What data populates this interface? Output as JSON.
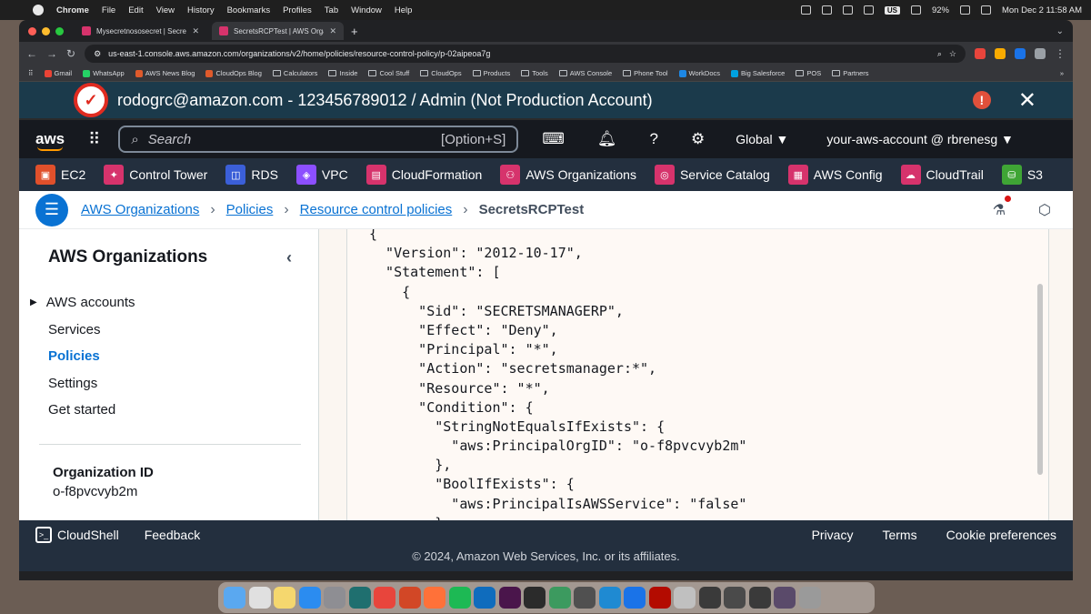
{
  "menubar": {
    "app": "Chrome",
    "items": [
      "File",
      "Edit",
      "View",
      "History",
      "Bookmarks",
      "Profiles",
      "Tab",
      "Window",
      "Help"
    ],
    "keyboard": "US",
    "battery": "92%",
    "clock": "Mon Dec 2  11:58 AM"
  },
  "browser": {
    "tabs": [
      {
        "label": "Mysecretnososecret | Secre",
        "active": false
      },
      {
        "label": "SecretsRCPTest | AWS Organ",
        "active": true
      }
    ],
    "url": "us-east-1.console.aws.amazon.com/organizations/v2/home/policies/resource-control-policy/p-02aipeoa7g",
    "bookmarks": [
      {
        "label": "Gmail",
        "color": "#ea4335",
        "folder": false
      },
      {
        "label": "WhatsApp",
        "color": "#25d366",
        "folder": false
      },
      {
        "label": "AWS News Blog",
        "color": "#e05a2b",
        "folder": false
      },
      {
        "label": "CloudOps Blog",
        "color": "#e05a2b",
        "folder": false
      },
      {
        "label": "Calculators",
        "folder": true
      },
      {
        "label": "Inside",
        "folder": true
      },
      {
        "label": "Cool Stuff",
        "folder": true
      },
      {
        "label": "CloudOps",
        "folder": true
      },
      {
        "label": "Products",
        "folder": true
      },
      {
        "label": "Tools",
        "folder": true
      },
      {
        "label": "AWS Console",
        "folder": true
      },
      {
        "label": "Phone Tool",
        "folder": true
      },
      {
        "label": "WorkDocs",
        "color": "#1e88e5",
        "folder": false
      },
      {
        "label": "Big Salesforce",
        "color": "#00a1e0",
        "folder": false
      },
      {
        "label": "POS",
        "folder": true
      },
      {
        "label": "Partners",
        "folder": true
      }
    ],
    "more": "»"
  },
  "banner": {
    "text": "rodogrc@amazon.com - 123456789012 / Admin (Not Production Account)",
    "alert": "!",
    "close": "✕"
  },
  "awsnav": {
    "logo": "aws",
    "search_placeholder": "Search",
    "search_shortcut": "[Option+S]",
    "region": "Global ▼",
    "account": "your-aws-account @ rbrenesg ▼"
  },
  "favorites": [
    {
      "label": "EC2",
      "color": "#e0502b",
      "glyph": "▣"
    },
    {
      "label": "Control Tower",
      "color": "#d6336c",
      "glyph": "✦"
    },
    {
      "label": "RDS",
      "color": "#3b5fd8",
      "glyph": "◫"
    },
    {
      "label": "VPC",
      "color": "#8c4fff",
      "glyph": "◈"
    },
    {
      "label": "CloudFormation",
      "color": "#d6336c",
      "glyph": "▤"
    },
    {
      "label": "AWS Organizations",
      "color": "#d6336c",
      "glyph": "⚇"
    },
    {
      "label": "Service Catalog",
      "color": "#d6336c",
      "glyph": "◎"
    },
    {
      "label": "AWS Config",
      "color": "#d6336c",
      "glyph": "▦"
    },
    {
      "label": "CloudTrail",
      "color": "#d6336c",
      "glyph": "☁"
    },
    {
      "label": "S3",
      "color": "#3fa535",
      "glyph": "⛁"
    }
  ],
  "breadcrumbs": {
    "links": [
      "AWS Organizations",
      "Policies",
      "Resource control policies"
    ],
    "current": "SecretsRCPTest"
  },
  "sidebar": {
    "title": "AWS Organizations",
    "items": [
      {
        "label": "AWS accounts",
        "active": false,
        "expandable": true
      },
      {
        "label": "Services",
        "active": false,
        "expandable": false
      },
      {
        "label": "Policies",
        "active": true,
        "expandable": false
      },
      {
        "label": "Settings",
        "active": false,
        "expandable": false
      },
      {
        "label": "Get started",
        "active": false,
        "expandable": false
      }
    ],
    "org_label": "Organization ID",
    "org_value": "o-f8pvcvyb2m"
  },
  "policy_lines": [
    "{",
    "  \"Version\": \"2012-10-17\",",
    "  \"Statement\": [",
    "    {",
    "      \"Sid\": \"SECRETSMANAGERP\",",
    "      \"Effect\": \"Deny\",",
    "      \"Principal\": \"*\",",
    "      \"Action\": \"secretsmanager:*\",",
    "      \"Resource\": \"*\",",
    "      \"Condition\": {",
    "        \"StringNotEqualsIfExists\": {",
    "          \"aws:PrincipalOrgID\": \"o-f8pvcvyb2m\"",
    "        },",
    "        \"BoolIfExists\": {",
    "          \"aws:PrincipalIsAWSService\": \"false\"",
    "        }"
  ],
  "footer": {
    "cloudshell": "CloudShell",
    "feedback": "Feedback",
    "privacy": "Privacy",
    "terms": "Terms",
    "cookies": "Cookie preferences",
    "copyright": "© 2024, Amazon Web Services, Inc. or its affiliates."
  },
  "dock": {
    "apps": [
      {
        "name": "finder",
        "color": "#5aa8f0"
      },
      {
        "name": "launchpad",
        "color": "#e0e0e0"
      },
      {
        "name": "notes",
        "color": "#f5d76e"
      },
      {
        "name": "app-store",
        "color": "#2b8cf0"
      },
      {
        "name": "system-settings",
        "color": "#8e8e93"
      },
      {
        "name": "perplexity",
        "color": "#1f6f6f"
      },
      {
        "name": "chrome",
        "color": "#e8453c"
      },
      {
        "name": "powerpoint",
        "color": "#d24726"
      },
      {
        "name": "firefox",
        "color": "#ff7139"
      },
      {
        "name": "spotify",
        "color": "#1db954"
      },
      {
        "name": "outlook",
        "color": "#0f6cbd"
      },
      {
        "name": "slack",
        "color": "#4a154b"
      },
      {
        "name": "terminal",
        "color": "#2b2b2b"
      },
      {
        "name": "chrome-canary",
        "color": "#3c9a5f"
      },
      {
        "name": "calculator",
        "color": "#505050"
      },
      {
        "name": "vscode",
        "color": "#1f8ad2"
      },
      {
        "name": "chime",
        "color": "#1a73e8"
      },
      {
        "name": "acrobat",
        "color": "#b30b00"
      },
      {
        "name": "preview",
        "color": "#c0c0c0"
      },
      {
        "name": "window-1",
        "color": "#3a3a3a"
      },
      {
        "name": "window-2",
        "color": "#4a4a4a"
      },
      {
        "name": "window-3",
        "color": "#3a3a3a"
      },
      {
        "name": "window-4",
        "color": "#5a4a6a"
      },
      {
        "name": "trash",
        "color": "#9a9a9a"
      }
    ]
  }
}
